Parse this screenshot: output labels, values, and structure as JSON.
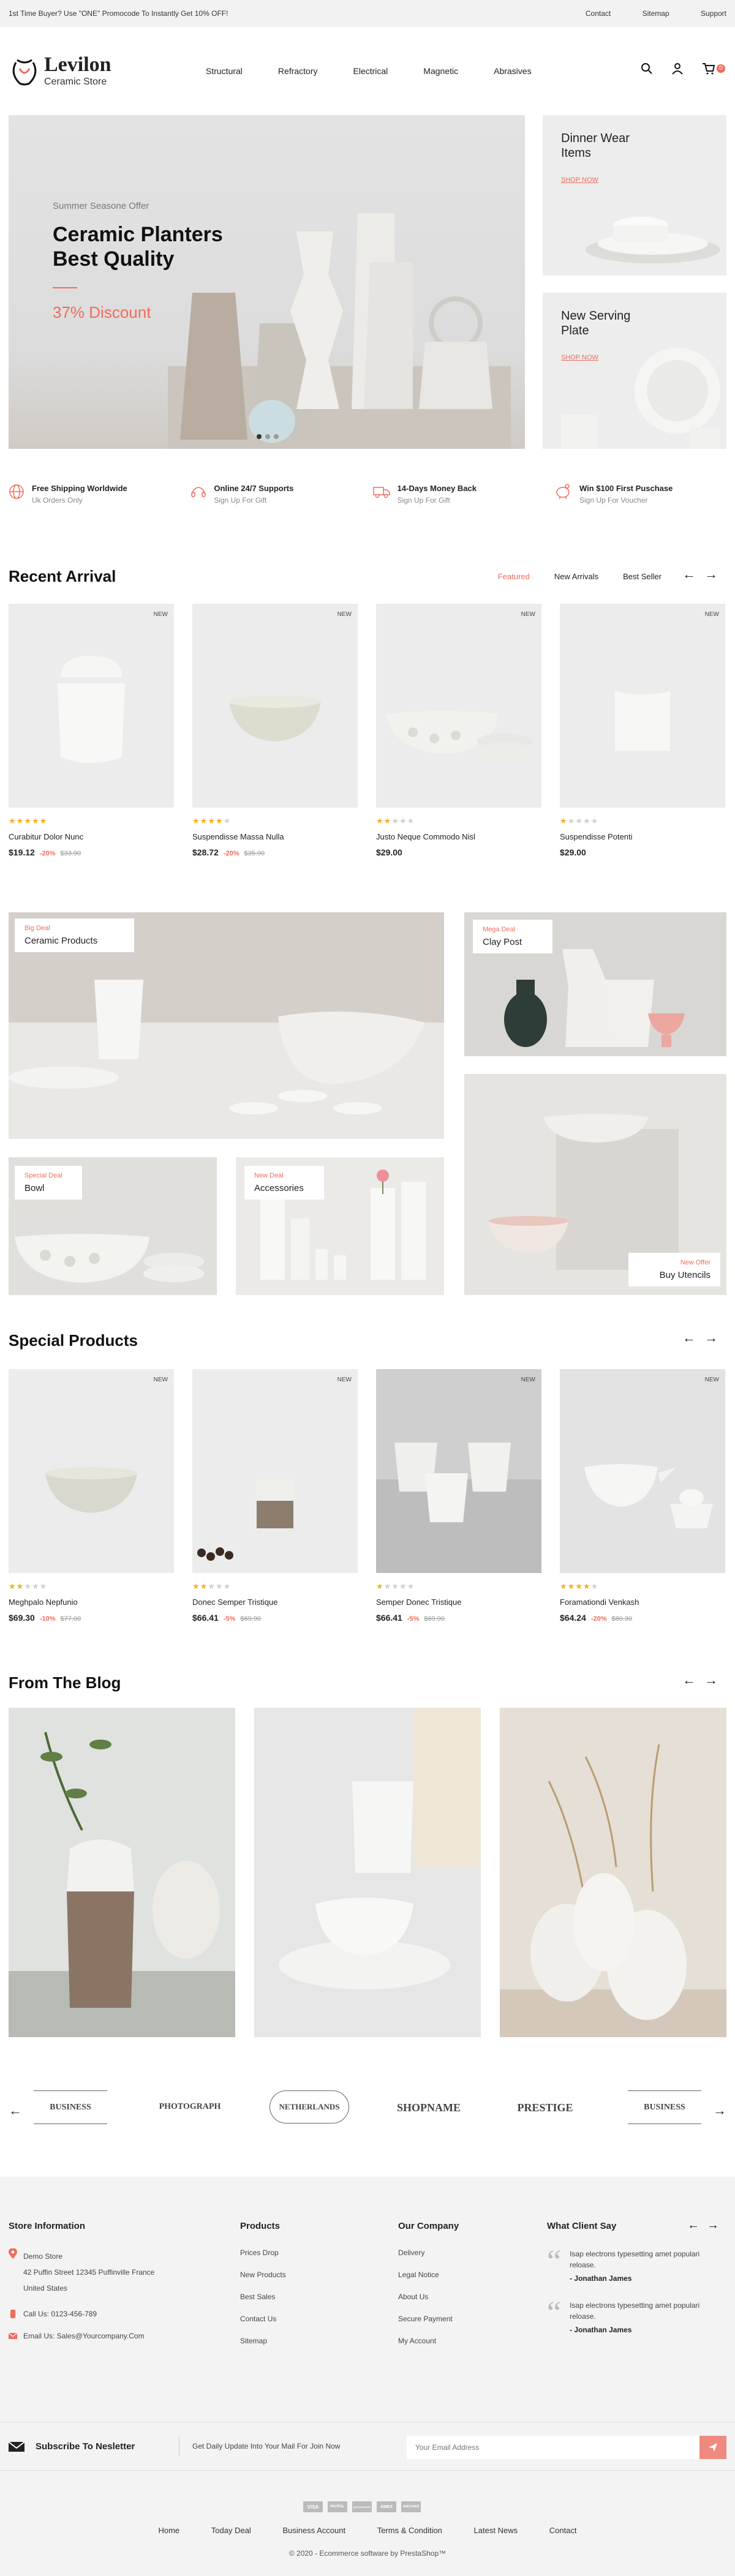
{
  "topbar": {
    "promo": "1st Time Buyer? Use \"ONE\" Promocode To Instantly Get 10% OFF!",
    "links": [
      "Contact",
      "Sitemap",
      "Support"
    ]
  },
  "logo": {
    "name": "Levilon",
    "tagline": "Ceramic Store"
  },
  "nav": [
    "Structural",
    "Refractory",
    "Electrical",
    "Magnetic",
    "Abrasives"
  ],
  "cart": {
    "count": "0"
  },
  "hero": {
    "offer": "Summer Seasone Offer",
    "title_l1": "Ceramic Planters",
    "title_l2": "Best Quality",
    "discount": "37% Discount"
  },
  "side1": {
    "t1": "Dinner Wear",
    "t2": "Items",
    "cta": "SHOP NOW"
  },
  "side2": {
    "t1": "New Serving",
    "t2": "Plate",
    "cta": "SHOP NOW"
  },
  "features": [
    {
      "title": "Free Shipping Worldwide",
      "sub": "Uk Orders Only"
    },
    {
      "title": "Online 24/7 Supports",
      "sub": "Sign Up For Gift"
    },
    {
      "title": "14-Days Money Back",
      "sub": "Sign Up For Gift"
    },
    {
      "title": "Win $100 First Puschase",
      "sub": "Sign Up For Voucher"
    }
  ],
  "recent": {
    "title": "Recent Arrival",
    "tabs": [
      "Featured",
      "New Arrivals",
      "Best Seller"
    ],
    "products": [
      {
        "badge": "NEW",
        "rating": 5,
        "name": "Curabitur Dolor Nunc",
        "price": "$19.12",
        "disc": "-20%",
        "old": "$33.90"
      },
      {
        "badge": "NEW",
        "rating": 4,
        "name": "Suspendisse Massa Nulla",
        "price": "$28.72",
        "disc": "-20%",
        "old": "$35.90"
      },
      {
        "badge": "NEW",
        "rating": 2,
        "name": "Justo Neque Commodo Nisl",
        "price": "$29.00",
        "disc": "",
        "old": ""
      },
      {
        "badge": "NEW",
        "rating": 1,
        "name": "Suspendisse Potenti",
        "price": "$29.00",
        "disc": "",
        "old": ""
      }
    ]
  },
  "banners": [
    {
      "kicker": "Big Deal",
      "label": "Ceramic Products"
    },
    {
      "kicker": "Mega Deal",
      "label": "Clay Post"
    },
    {
      "kicker": "Special Deal",
      "label": "Bowl"
    },
    {
      "kicker": "New Deal",
      "label": "Accessories"
    },
    {
      "kicker": "New Offer",
      "label": "Buy Utencils"
    }
  ],
  "special": {
    "title": "Special Products",
    "products": [
      {
        "badge": "NEW",
        "rating": 2,
        "name": "Meghpalo Nepfunio",
        "price": "$69.30",
        "disc": "-10%",
        "old": "$77.00"
      },
      {
        "badge": "NEW",
        "rating": 2,
        "name": "Donec Semper Tristique",
        "price": "$66.41",
        "disc": "-5%",
        "old": "$69.90"
      },
      {
        "badge": "NEW",
        "rating": 1,
        "name": "Semper Donec Tristique",
        "price": "$66.41",
        "disc": "-5%",
        "old": "$69.90"
      },
      {
        "badge": "NEW",
        "rating": 4,
        "name": "Foramationdi Venkash",
        "price": "$64.24",
        "disc": "-20%",
        "old": "$80.30"
      }
    ]
  },
  "blog": {
    "title": "From The Blog"
  },
  "brands": [
    "BUSINESS",
    "PHOTOGRAPH",
    "NETHERLANDS",
    "SHOPNAME",
    "PRESTIGE",
    "BUSINESS"
  ],
  "footer": {
    "store": {
      "title": "Store Information",
      "name": "Demo Store",
      "address": "42 Puffin Street 12345 Puffinville France",
      "country": "United States",
      "call": "Call Us: 0123-456-789",
      "email": "Email Us: Sales@Yourcompany.Com"
    },
    "products": {
      "title": "Products",
      "items": [
        "Prices Drop",
        "New Products",
        "Best Sales",
        "Contact Us",
        "Sitemap"
      ]
    },
    "company": {
      "title": "Our Company",
      "items": [
        "Delivery",
        "Legal Notice",
        "About Us",
        "Secure Payment",
        "My Account"
      ]
    },
    "testimonials": {
      "title": "What Client Say",
      "items": [
        {
          "text": "Isap electrons typesetting amet populari reloase.",
          "author": "- Jonathan James"
        },
        {
          "text": "Isap electrons typesetting amet populari reloase.",
          "author": "- Jonathan James"
        }
      ]
    },
    "newsletter": {
      "title": "Subscribe To Nesletter",
      "desc": "Get Daily Update Into Your Mail For Join Now",
      "placeholder": "Your Email Address"
    },
    "payments": [
      "VISA",
      "PAYPAL",
      "MASTERCARD",
      "AMEX",
      "DISCOVER"
    ],
    "links": [
      "Home",
      "Today Deal",
      "Business Account",
      "Terms & Condition",
      "Latest News",
      "Contact"
    ],
    "copyright": "© 2020 - Ecommerce software by PrestaShop™"
  },
  "colors": {
    "accent": "#f06c5c",
    "footer_bg": "#f3f3f3"
  }
}
